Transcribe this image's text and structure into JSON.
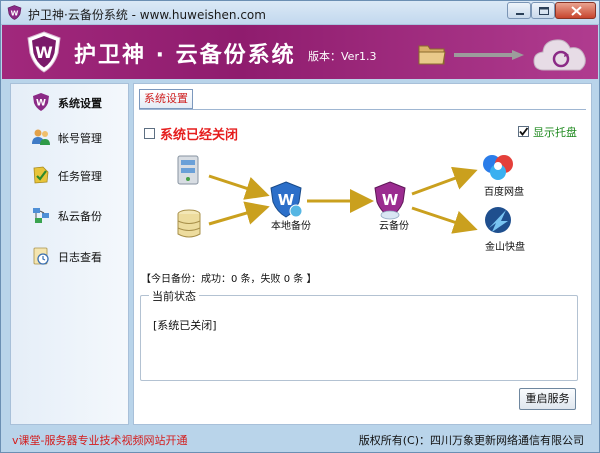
{
  "window": {
    "title": "护卫神·云备份系统 - www.huweishen.com"
  },
  "banner": {
    "brand": "护卫神 · 云备份系统",
    "version": "版本：Ver1.3"
  },
  "sidebar": {
    "items": [
      {
        "label": "系统设置",
        "icon": "shield-settings-icon",
        "active": true
      },
      {
        "label": "帐号管理",
        "icon": "users-icon",
        "active": false
      },
      {
        "label": "任务管理",
        "icon": "tasks-icon",
        "active": false
      },
      {
        "label": "私云备份",
        "icon": "private-cloud-icon",
        "active": false
      },
      {
        "label": "日志查看",
        "icon": "log-icon",
        "active": false
      }
    ]
  },
  "main": {
    "tab_label": "系统设置",
    "status_checkbox_label": "系统已经关闭",
    "status_checkbox_checked": false,
    "tray_checkbox_label": "显示托盘",
    "tray_checkbox_checked": true,
    "flow": {
      "local_backup_label": "本地备份",
      "cloud_backup_label": "云备份",
      "baidu_label": "百度网盘",
      "kingsoft_label": "金山快盘"
    },
    "today_summary": "【今日备份：成功：0 条，失败 0 条 】",
    "current_status_title": "当前状态",
    "current_status_text": "[系统已关闭]",
    "restart_button": "重启服务"
  },
  "footer": {
    "left_text": "v课堂-服务器专业技术视频网站开通",
    "right_text": "版权所有(C)：四川万象更新网络通信有限公司"
  },
  "colors": {
    "banner": "#a1287c",
    "status_red": "#e51d1d",
    "tray_green": "#1f8a1f",
    "arrow_gold": "#caa01e"
  }
}
